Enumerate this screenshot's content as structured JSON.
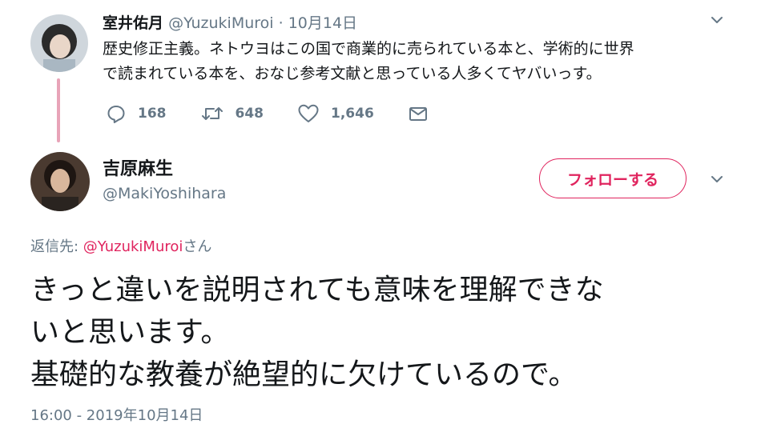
{
  "tweet1": {
    "name": "室井佑月",
    "handle": "@YuzukiMuroi",
    "separator": "·",
    "date": "10月14日",
    "text_line1": "歴史修正主義。ネトウヨはこの国で商業的に売られている本と、学術的に世界",
    "text_line2": "で読まれている本を、おなじ参考文献と思っている人多くてヤバいっす。",
    "reply_count": "168",
    "retweet_count": "648",
    "like_count": "1,646",
    "icons": {
      "reply": "reply-icon",
      "retweet": "retweet-icon",
      "like": "heart-icon",
      "dm": "envelope-icon",
      "menu": "chevron-down-icon"
    }
  },
  "tweet2": {
    "name": "吉原麻生",
    "handle": "@MakiYoshihara",
    "follow_label": "フォローする",
    "reply_prefix": "返信先: ",
    "reply_mention": "@YuzukiMuroi",
    "reply_suffix": "さん",
    "text_line1": "きっと違いを説明されても意味を理解できな",
    "text_line2": "いと思います。",
    "text_line3": "基礎的な教養が絶望的に欠けているので。",
    "timestamp": "16:00 - 2019年10月14日"
  },
  "colors": {
    "accent": "#e0245e",
    "muted": "#657786",
    "text": "#14171a",
    "thread_line": "#e8a4b8"
  }
}
